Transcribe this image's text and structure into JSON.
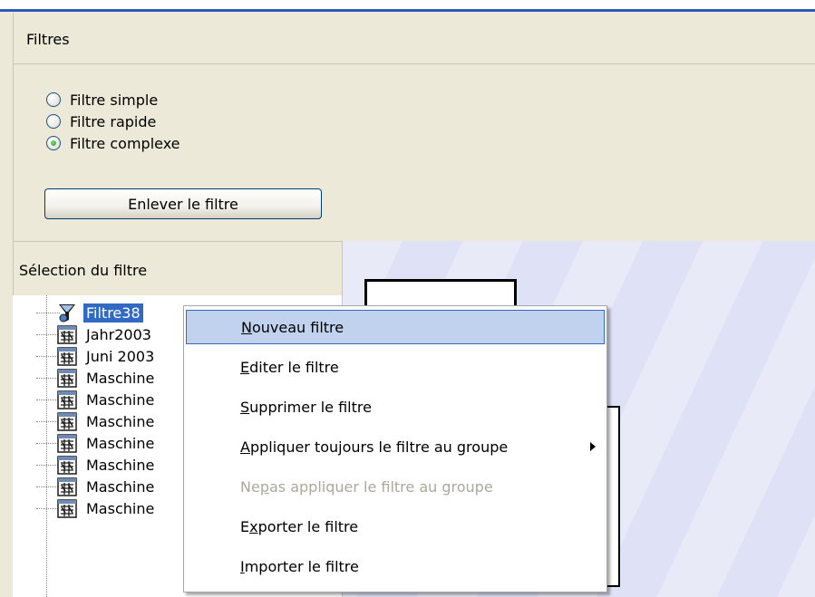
{
  "header": {
    "title": "Filtres"
  },
  "filter_type": {
    "options": [
      {
        "label": "Filtre simple",
        "checked": false
      },
      {
        "label": "Filtre rapide",
        "checked": false
      },
      {
        "label": "Filtre complexe",
        "checked": true
      }
    ],
    "remove_button": "Enlever le filtre"
  },
  "selection": {
    "title": "Sélection du filtre",
    "items": [
      {
        "label": "Filtre38",
        "selected": true,
        "icon": "filter-funnel-icon"
      },
      {
        "label": "Jahr2003",
        "icon": "filter-list-icon"
      },
      {
        "label": "Juni 2003",
        "icon": "filter-list-icon"
      },
      {
        "label": "Maschine",
        "icon": "filter-list-icon"
      },
      {
        "label": "Maschine",
        "icon": "filter-list-icon"
      },
      {
        "label": "Maschine",
        "icon": "filter-list-icon"
      },
      {
        "label": "Maschine",
        "icon": "filter-list-icon"
      },
      {
        "label": "Maschine",
        "icon": "filter-list-icon"
      },
      {
        "label": "Maschine",
        "icon": "filter-list-icon"
      },
      {
        "label": "Maschine",
        "icon": "filter-list-icon"
      }
    ]
  },
  "context_menu": {
    "items": [
      {
        "pre": "",
        "key": "N",
        "post": "ouveau filtre",
        "hover": true
      },
      {
        "pre": "",
        "key": "E",
        "post": "diter le filtre"
      },
      {
        "pre": "",
        "key": "S",
        "post": "upprimer le filtre"
      },
      {
        "pre": "",
        "key": "A",
        "post": "ppliquer toujours le filtre au groupe",
        "submenu": true
      },
      {
        "pre": "Ne ",
        "key": "p",
        "post": "as appliquer le filtre au groupe",
        "disabled": true
      },
      {
        "pre": "E",
        "key": "x",
        "post": "porter le filtre"
      },
      {
        "pre": "",
        "key": "I",
        "post": "mporter le filtre"
      }
    ]
  },
  "colors": {
    "selection": "#316ac5",
    "menu_hover": "#c1d2ee",
    "accent_blue": "#2b5bb8"
  }
}
